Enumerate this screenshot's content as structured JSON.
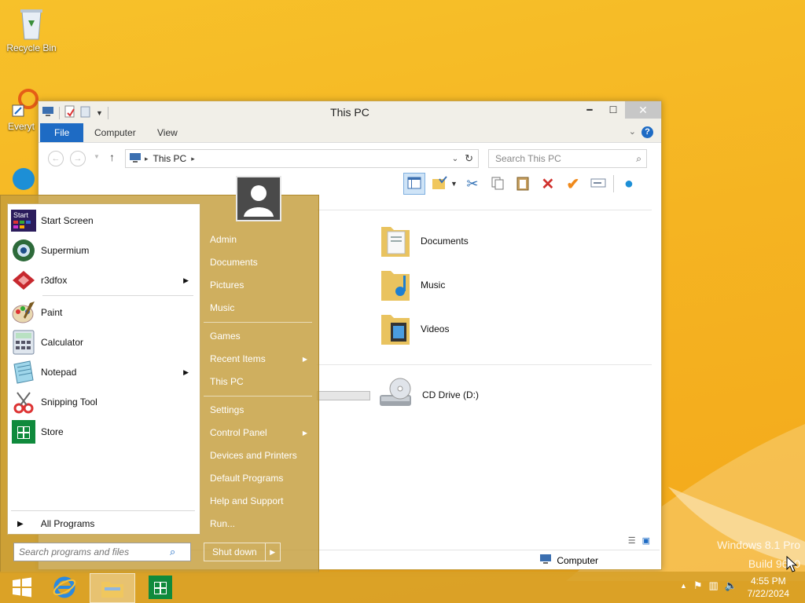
{
  "desktop": {
    "recycle_bin": "Recycle Bin",
    "everything": "Everyt",
    "watermark_line1": "Windows 8.1 Pro",
    "watermark_line2": "Build 9600"
  },
  "explorer": {
    "title": "This PC",
    "tabs": {
      "file": "File",
      "computer": "Computer",
      "view": "View"
    },
    "address": "This PC",
    "search_placeholder": "Search This PC",
    "items": [
      {
        "label": "Documents"
      },
      {
        "label": "Music"
      },
      {
        "label": "Videos"
      },
      {
        "label": "CD Drive (D:)"
      }
    ],
    "status_location": "Computer"
  },
  "start_menu": {
    "left_items": [
      {
        "label": "Start Screen"
      },
      {
        "label": "Supermium"
      },
      {
        "label": "r3dfox"
      },
      {
        "label": "Paint"
      },
      {
        "label": "Calculator"
      },
      {
        "label": "Notepad"
      },
      {
        "label": "Snipping Tool"
      },
      {
        "label": "Store"
      }
    ],
    "all_programs": "All Programs",
    "search_placeholder": "Search programs and files",
    "right_items": [
      {
        "label": "Admin"
      },
      {
        "label": "Documents"
      },
      {
        "label": "Pictures"
      },
      {
        "label": "Music"
      },
      {
        "label": "Games"
      },
      {
        "label": "Recent Items"
      },
      {
        "label": "This PC"
      },
      {
        "label": "Settings"
      },
      {
        "label": "Control Panel"
      },
      {
        "label": "Devices and Printers"
      },
      {
        "label": "Default Programs"
      },
      {
        "label": "Help and Support"
      },
      {
        "label": "Run..."
      }
    ],
    "shutdown": "Shut down",
    "start_tile_text": "Start"
  },
  "taskbar": {
    "time": "4:55 PM",
    "date": "7/22/2024"
  },
  "colors": {
    "accent_blue": "#1e6bc4",
    "wallpaper": "#f5b422",
    "start_menu": "#c49e3c"
  }
}
